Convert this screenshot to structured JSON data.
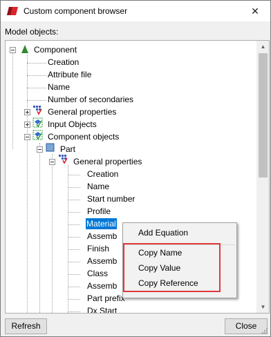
{
  "window": {
    "title": "Custom component browser",
    "close_glyph": "✕"
  },
  "panel_label": "Model objects:",
  "tree": {
    "root": "Component",
    "root_children": [
      "Creation",
      "Attribute file",
      "Name",
      "Number of secondaries"
    ],
    "groups": [
      "General properties",
      "Input Objects",
      "Component objects"
    ],
    "part": "Part",
    "part_group": "General properties",
    "part_props": [
      "Creation",
      "Name",
      "Start number",
      "Profile",
      "Material",
      "Assemb",
      "Finish",
      "Assemb",
      "Class",
      "Assemb",
      "Part prefix",
      "Dx Start"
    ],
    "selected": "Material"
  },
  "context_menu": {
    "items": [
      "Add Equation",
      "Copy Name",
      "Copy Value",
      "Copy Reference"
    ],
    "highlight_color": "#e0383a"
  },
  "buttons": {
    "refresh": "Refresh",
    "close": "Close"
  },
  "colors": {
    "selection": "#0078d7",
    "accent_red": "#e0383a"
  }
}
